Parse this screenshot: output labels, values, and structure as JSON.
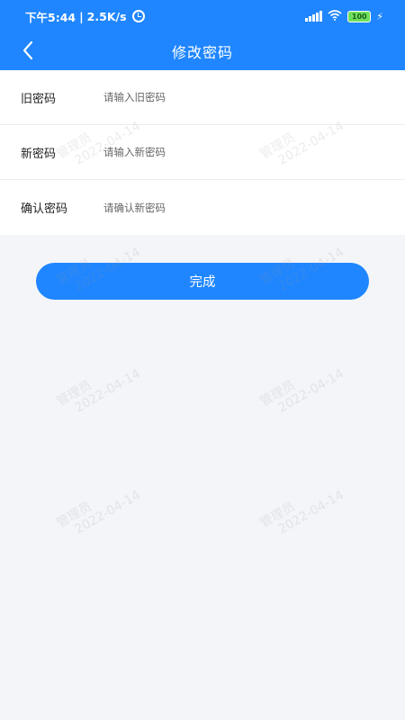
{
  "status_bar": {
    "time": "下午5:44",
    "network_speed": "2.5K/s",
    "separator": "|",
    "battery": "100",
    "alarm_icon": "alarm-clock-icon",
    "signal_icon": "signal-bars-icon",
    "wifi_icon": "wifi-icon",
    "charge_icon": "charging-bolt-icon"
  },
  "nav": {
    "title": "修改密码",
    "back_icon": "chevron-left-icon"
  },
  "form": {
    "old_password": {
      "label": "旧密码",
      "placeholder": "请输入旧密码"
    },
    "new_password": {
      "label": "新密码",
      "placeholder": "请输入新密码"
    },
    "confirm_password": {
      "label": "确认密码",
      "placeholder": "请确认新密码"
    }
  },
  "submit_label": "完成",
  "watermark": {
    "name": "管理员",
    "date": "2022-04-14"
  },
  "colors": {
    "primary": "#1f86ff",
    "background": "#f4f5f9"
  }
}
